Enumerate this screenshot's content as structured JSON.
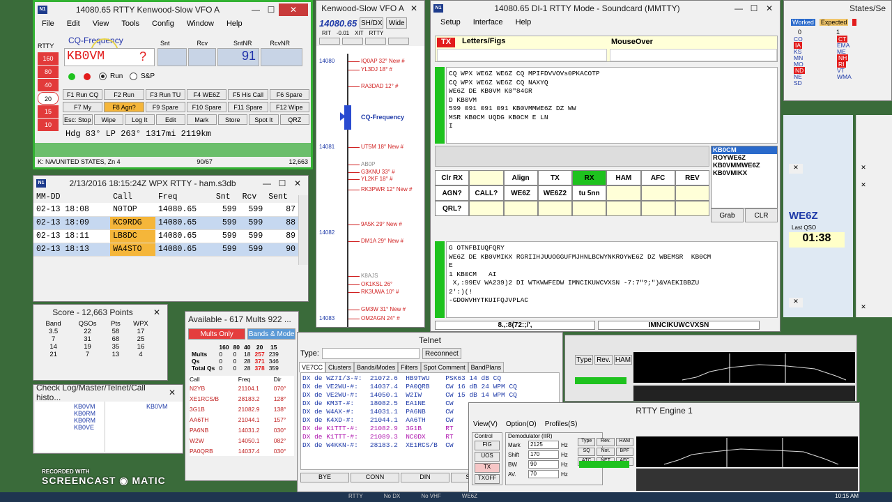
{
  "colors": {
    "accent_red": "#e03030",
    "highlight_orange": "#f5b63a",
    "selected_blue": "#c6d8f0",
    "green": "#1ec21e",
    "mmtty_blue": "#1e3a8a"
  },
  "entry": {
    "title": "14080.65 RTTY Kenwood-Slow VFO A",
    "menu": [
      "File",
      "Edit",
      "View",
      "Tools",
      "Config",
      "Window",
      "Help"
    ],
    "rtty_label": "RTTY",
    "bands": [
      "160",
      "80",
      "40",
      "20",
      "15",
      "10"
    ],
    "cq_label": "CQ-Frequency",
    "call_value": "KB0VM",
    "question": "?",
    "col_labels": [
      "Snt",
      "Rcv",
      "SntNR",
      "RcvNR"
    ],
    "sntnr": "91",
    "run_label": "Run",
    "sp_label": "S&P",
    "fkeys": [
      [
        "F1 Run CQ",
        "F2 Run",
        "F3 Run TU",
        "F4 WE6Z",
        "F5 His Call",
        "F6 Spare"
      ],
      [
        "F7 My",
        "F8 Agn?",
        "F9 Spare",
        "F10 Spare",
        "F11 Spare",
        "F12 Wipe"
      ],
      [
        "Esc: Stop",
        "Wipe",
        "Log It",
        "Edit",
        "Mark",
        "Store",
        "Spot It",
        "QRZ"
      ]
    ],
    "info": "Hdg 83° LP 263° 1317mi 2119km",
    "status_left": "K: NA/UNITED STATES, Zn 4",
    "status_mid": "90/67",
    "status_right": "12,663"
  },
  "log": {
    "title": "2/13/2016 18:15:24Z  WPX RTTY - ham.s3db",
    "headers": [
      "MM-DD",
      "Call",
      "Freq",
      "Snt",
      "Rcv",
      "Sent"
    ],
    "rows": [
      [
        "02-13 18:08",
        "N0TOP",
        "14080.65",
        "599",
        "599",
        "87"
      ],
      [
        "02-13 18:09",
        "KC9RDG",
        "14080.65",
        "599",
        "599",
        "88"
      ],
      [
        "02-13 18:11",
        "LB8DC",
        "14080.65",
        "599",
        "599",
        "89"
      ],
      [
        "02-13 18:13",
        "WA4STO",
        "14080.65",
        "599",
        "599",
        "90"
      ]
    ]
  },
  "score": {
    "title": "Score - 12,663 Points",
    "headers": [
      "Band",
      "QSOs",
      "Pts",
      "WPX"
    ],
    "rows": [
      [
        "3.5",
        "22",
        "58",
        "17"
      ],
      [
        "7",
        "31",
        "68",
        "25"
      ],
      [
        "14",
        "19",
        "35",
        "16"
      ],
      [
        "21",
        "7",
        "13",
        "4"
      ]
    ]
  },
  "check": {
    "title": "Check Log/Master/Telnet/Call histo...",
    "left": [
      "KB0VM",
      "KB0RM",
      "KB0RM",
      "KB0VE"
    ],
    "right": [
      "KB0VM"
    ]
  },
  "available": {
    "title": "Available - 617 Mults 922 ...",
    "mults_only": "Mults Only",
    "bands_modes": "Bands & Mode",
    "band_headers": [
      "160",
      "80",
      "40",
      "20",
      "15"
    ],
    "summary": [
      [
        "Mults",
        "0",
        "0",
        "18",
        "257",
        "239"
      ],
      [
        "Qs",
        "0",
        "0",
        "28",
        "371",
        "346"
      ],
      [
        "Total Qs",
        "0",
        "0",
        "28",
        "378",
        "359"
      ]
    ],
    "list_headers": [
      "Call",
      "Freq",
      "Dir"
    ],
    "list": [
      [
        "N2YB",
        "21104.1",
        "070°"
      ],
      [
        "XE1RCS/B",
        "28183.2",
        "128°"
      ],
      [
        "3G1B",
        "21082.9",
        "138°"
      ],
      [
        "AA6TH",
        "21044.1",
        "157°"
      ],
      [
        "PA6NB",
        "14031.2",
        "030°"
      ],
      [
        "W2W",
        "14050.1",
        "082°"
      ],
      [
        "PA0QRB",
        "14037.4",
        "030°"
      ]
    ]
  },
  "telnet": {
    "title": "Telnet",
    "type_label": "Type:",
    "reconnect": "Reconnect",
    "tabs": [
      "VE7CC",
      "Clusters",
      "Bands/Modes",
      "Filters",
      "Spot Comment",
      "BandPlans"
    ],
    "spots": [
      [
        "DX de WZ7I/3-#:",
        "21072.6",
        "HB9TWU",
        "PSK63 14 dB CQ"
      ],
      [
        "DX de VE2WU-#:",
        "14037.4",
        "PA0QRB",
        "CW 16 dB 24 WPM CQ"
      ],
      [
        "DX de VE2WU-#:",
        "14050.1",
        "W2IW",
        "CW 15 dB 14 WPM CQ"
      ],
      [
        "DX de KM3T-#:",
        "18082.5",
        "EA1NE",
        "CW"
      ],
      [
        "DX de W4AX-#:",
        "14031.1",
        "PA6NB",
        "CW"
      ],
      [
        "DX de K4XD-#:",
        "21044.1",
        "AA6TH",
        "CW"
      ],
      [
        "DX de K1TTT-#:",
        "21082.9",
        "3G1B",
        "RT"
      ],
      [
        "DX de K1TTT-#:",
        "21089.3",
        "NC0DX",
        "RT"
      ],
      [
        "DX de W4KKN-#:",
        "28183.2",
        "XE1RCS/B",
        "CW"
      ]
    ],
    "buttons": [
      "BYE",
      "CONN",
      "DIN",
      "SH/DX"
    ]
  },
  "bandmap": {
    "title": "Kenwood-Slow VFO A",
    "freq": "14080.65",
    "shdx": "SH/DX",
    "wide": "Wide",
    "rit_labels": [
      "RIT",
      "-0.01",
      "XIT",
      "RTTY"
    ],
    "ticks": [
      "14080",
      "14081",
      "14082",
      "14083"
    ],
    "cq": "CQ-Frequency",
    "spots": [
      "IQ0AP 32° New #",
      "YL3DJ 18° #",
      "RA3DAD 12° #",
      "UT5M 18° New #",
      "AB0P",
      "G3KNU 33° #",
      "YL2KF 18° #",
      "RK3PWR 12° New #",
      "9A5K 29° New #",
      "DM1A 29° New #",
      "K8AJS",
      "OK1KSL 26°",
      "RK3UWA 10° #",
      "GM3W 31° New #",
      "OM2AGN 24° #"
    ]
  },
  "mmtty": {
    "title": "14080.65  DI-1 RTTY Mode - Soundcard (MMTTY)",
    "menu": [
      "Setup",
      "Interface",
      "Help"
    ],
    "tx": "TX",
    "letters": "Letters/Figs",
    "mouseover": "MouseOver",
    "rx_lines": [
      "CQ WPX WE6Z WE6Z CQ MPIFDVVOVs0PKACOTP",
      "CQ WPX WE6Z WE6Z CQ NAXYQ",
      "WE6Z DE KB0VM K0\"84GR",
      "D KB0VM",
      "599 091 091 091 KB0VMMWE6Z DZ WW",
      "MSR KB0CM UQDG KB0CM E LN",
      "I"
    ],
    "call_list": [
      "KB0CM",
      "ROYWE6Z",
      "KB0VMMWE6Z",
      "KB0VMIKX"
    ],
    "row1": [
      "Clr RX",
      "",
      "Align",
      "TX",
      "RX",
      "HAM",
      "AFC",
      "REV"
    ],
    "row2": [
      "AGN?",
      "CALL?",
      "WE6Z",
      "WE6Z2",
      "tu 5nn"
    ],
    "row3": [
      "QRL?"
    ],
    "grab": "Grab",
    "clr": "CLR",
    "rx2_lines": [
      "G OTNFBIUQFQRY",
      "WE6Z DE KB0VMIKX RGRIIHJUUOGGUFMJHNLBCWYNKROYWE6Z DZ WBEMSR  KB0CM",
      "E",
      "1 KB0CM   AI",
      " X,:99EV WA239)2 DI WTKWWFEDW IMNCIKUWCVXSN -7:7\"?;\")&VAEKIBBZU",
      "2':)(!",
      "-GDOWVHYTKUIFQJVPLAC"
    ],
    "status1": "8.,:8(72:;/',",
    "status2": "IMNCIKUWCVXSN"
  },
  "states": {
    "title": "States/Se",
    "worked": "Worked",
    "expected": "Expected",
    "w_count": "0",
    "e_count": "1",
    "left": [
      "CO",
      "IA",
      "KS",
      "MN",
      "MO",
      "ND",
      "NE",
      "SD"
    ],
    "right": [
      "CT",
      "EMA",
      "ME",
      "NH",
      "RI",
      "VT",
      "WMA"
    ]
  },
  "qso": {
    "call": "WE6Z",
    "last_qso_label": "Last QSO",
    "time": "01:38"
  },
  "engine": {
    "title": "RTTY Engine 1",
    "menu": [
      "View(V)",
      "Option(O)",
      "Profiles(S)"
    ],
    "control": "Control",
    "demod": "Demodulator (IIR)",
    "btns": [
      "FIG",
      "UOS",
      "TX",
      "TXOFF"
    ],
    "fields": [
      [
        "Mark",
        "2125",
        "Hz"
      ],
      [
        "Shift",
        "170",
        "Hz"
      ],
      [
        "BW",
        "90",
        "Hz"
      ],
      [
        "AV.",
        "70",
        "Hz"
      ]
    ],
    "opts": [
      "Type",
      "Rev.",
      "HAM",
      "SQ",
      "Not.",
      "BPF",
      "ATC",
      "NET",
      "AFC"
    ]
  },
  "taskbar": {
    "items": [
      "RTTY",
      "No DX",
      "No VHF",
      "WE6Z"
    ],
    "time": "10:15 AM"
  },
  "watermark": {
    "line1": "RECORDED WITH",
    "line2": "SCREENCAST",
    "line3": "MATIC"
  }
}
